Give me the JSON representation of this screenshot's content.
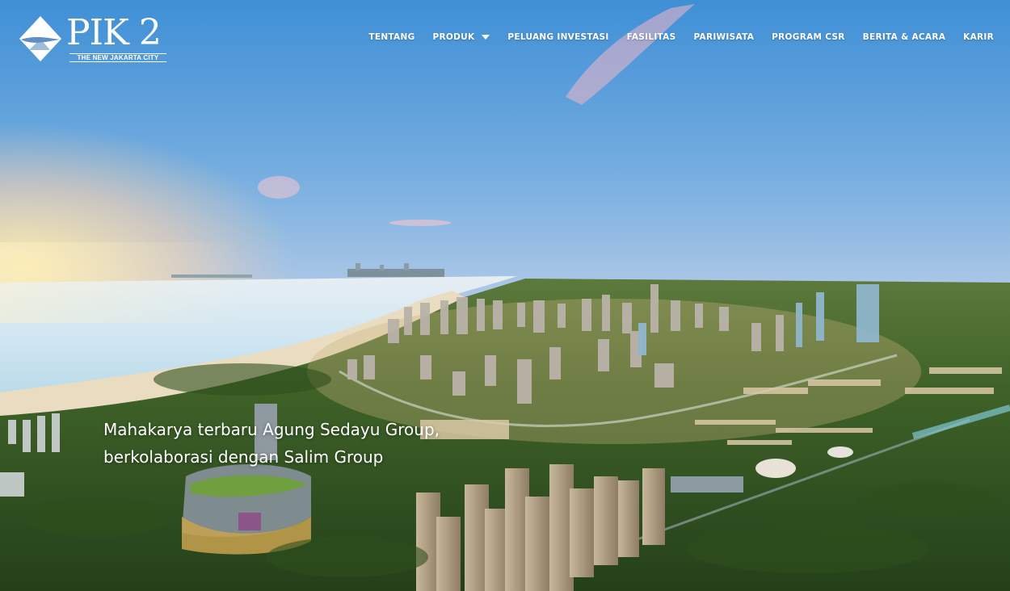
{
  "brand": {
    "name": "PIK 2",
    "tagline": "THE NEW JAKARTA CITY"
  },
  "nav": {
    "items": [
      {
        "label": "TENTANG"
      },
      {
        "label": "PRODUK",
        "has_dropdown": true
      },
      {
        "label": "PELUANG INVESTASI"
      },
      {
        "label": "FASILITAS"
      },
      {
        "label": "PARIWISATA"
      },
      {
        "label": "PROGRAM CSR"
      },
      {
        "label": "BERITA & ACARA"
      },
      {
        "label": "KARIR"
      }
    ]
  },
  "hero": {
    "headline": "Mahakarya terbaru Agung Sedayu Group, berkolaborasi dengan Salim Group"
  },
  "colors": {
    "sky_top": "#3f8fd6",
    "sea": "#cfe6f2",
    "land": "#3a5a22",
    "text": "#ffffff"
  }
}
